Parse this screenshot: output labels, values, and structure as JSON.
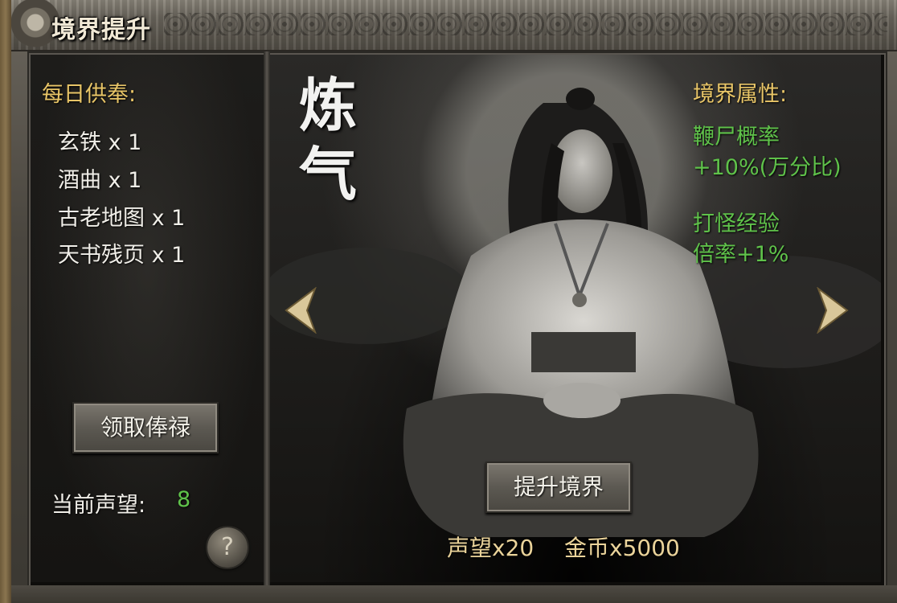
{
  "window": {
    "title": "境界提升"
  },
  "daily_offering": {
    "heading": "每日供奉:",
    "items": [
      {
        "label": "玄铁 x 1"
      },
      {
        "label": "酒曲 x 1"
      },
      {
        "label": "古老地图 x 1"
      },
      {
        "label": "天书残页 x 1"
      }
    ],
    "claim_button": "领取俸禄",
    "prestige_label": "当前声望:",
    "prestige_value": "8",
    "help_icon": "?"
  },
  "realm": {
    "name_calligraphy": "炼气",
    "attributes_heading": "境界属性:",
    "attribute_lines": [
      "鞭尸概率",
      "+10%(万分比)",
      "打怪经验",
      "倍率+1%"
    ],
    "upgrade_button": "提升境界",
    "cost_prestige": "声望x20",
    "cost_gold": "金币x5000"
  },
  "colors": {
    "gold_text": "#e8c567",
    "green_text": "#5fc24a",
    "cost_text": "#ead39a"
  },
  "icons": {
    "prev": "triangle-left-arrow-icon",
    "next": "triangle-right-arrow-icon",
    "help": "question-mark-icon"
  }
}
